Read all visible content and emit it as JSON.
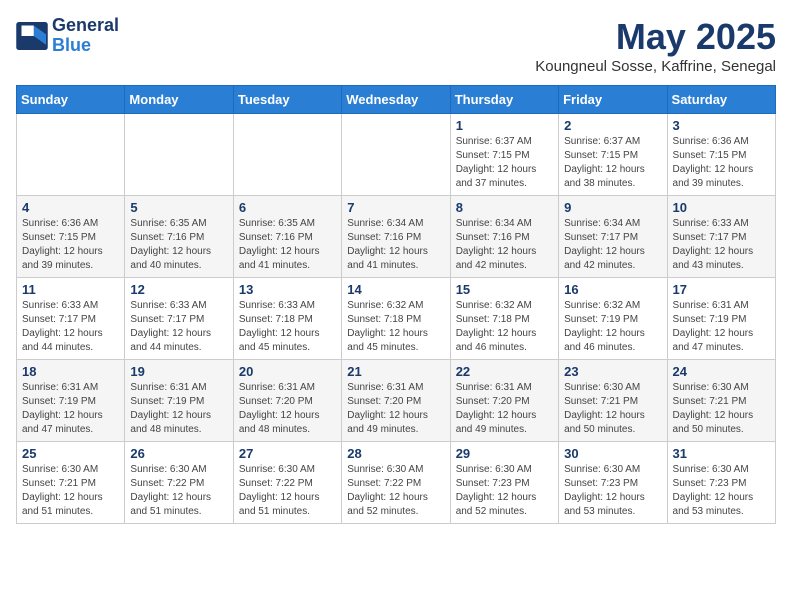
{
  "header": {
    "logo_line1": "General",
    "logo_line2": "Blue",
    "month": "May 2025",
    "location": "Koungneul Sosse, Kaffrine, Senegal"
  },
  "weekdays": [
    "Sunday",
    "Monday",
    "Tuesday",
    "Wednesday",
    "Thursday",
    "Friday",
    "Saturday"
  ],
  "weeks": [
    [
      {
        "day": "",
        "info": ""
      },
      {
        "day": "",
        "info": ""
      },
      {
        "day": "",
        "info": ""
      },
      {
        "day": "",
        "info": ""
      },
      {
        "day": "1",
        "info": "Sunrise: 6:37 AM\nSunset: 7:15 PM\nDaylight: 12 hours and 37 minutes."
      },
      {
        "day": "2",
        "info": "Sunrise: 6:37 AM\nSunset: 7:15 PM\nDaylight: 12 hours and 38 minutes."
      },
      {
        "day": "3",
        "info": "Sunrise: 6:36 AM\nSunset: 7:15 PM\nDaylight: 12 hours and 39 minutes."
      }
    ],
    [
      {
        "day": "4",
        "info": "Sunrise: 6:36 AM\nSunset: 7:15 PM\nDaylight: 12 hours and 39 minutes."
      },
      {
        "day": "5",
        "info": "Sunrise: 6:35 AM\nSunset: 7:16 PM\nDaylight: 12 hours and 40 minutes."
      },
      {
        "day": "6",
        "info": "Sunrise: 6:35 AM\nSunset: 7:16 PM\nDaylight: 12 hours and 41 minutes."
      },
      {
        "day": "7",
        "info": "Sunrise: 6:34 AM\nSunset: 7:16 PM\nDaylight: 12 hours and 41 minutes."
      },
      {
        "day": "8",
        "info": "Sunrise: 6:34 AM\nSunset: 7:16 PM\nDaylight: 12 hours and 42 minutes."
      },
      {
        "day": "9",
        "info": "Sunrise: 6:34 AM\nSunset: 7:17 PM\nDaylight: 12 hours and 42 minutes."
      },
      {
        "day": "10",
        "info": "Sunrise: 6:33 AM\nSunset: 7:17 PM\nDaylight: 12 hours and 43 minutes."
      }
    ],
    [
      {
        "day": "11",
        "info": "Sunrise: 6:33 AM\nSunset: 7:17 PM\nDaylight: 12 hours and 44 minutes."
      },
      {
        "day": "12",
        "info": "Sunrise: 6:33 AM\nSunset: 7:17 PM\nDaylight: 12 hours and 44 minutes."
      },
      {
        "day": "13",
        "info": "Sunrise: 6:33 AM\nSunset: 7:18 PM\nDaylight: 12 hours and 45 minutes."
      },
      {
        "day": "14",
        "info": "Sunrise: 6:32 AM\nSunset: 7:18 PM\nDaylight: 12 hours and 45 minutes."
      },
      {
        "day": "15",
        "info": "Sunrise: 6:32 AM\nSunset: 7:18 PM\nDaylight: 12 hours and 46 minutes."
      },
      {
        "day": "16",
        "info": "Sunrise: 6:32 AM\nSunset: 7:19 PM\nDaylight: 12 hours and 46 minutes."
      },
      {
        "day": "17",
        "info": "Sunrise: 6:31 AM\nSunset: 7:19 PM\nDaylight: 12 hours and 47 minutes."
      }
    ],
    [
      {
        "day": "18",
        "info": "Sunrise: 6:31 AM\nSunset: 7:19 PM\nDaylight: 12 hours and 47 minutes."
      },
      {
        "day": "19",
        "info": "Sunrise: 6:31 AM\nSunset: 7:19 PM\nDaylight: 12 hours and 48 minutes."
      },
      {
        "day": "20",
        "info": "Sunrise: 6:31 AM\nSunset: 7:20 PM\nDaylight: 12 hours and 48 minutes."
      },
      {
        "day": "21",
        "info": "Sunrise: 6:31 AM\nSunset: 7:20 PM\nDaylight: 12 hours and 49 minutes."
      },
      {
        "day": "22",
        "info": "Sunrise: 6:31 AM\nSunset: 7:20 PM\nDaylight: 12 hours and 49 minutes."
      },
      {
        "day": "23",
        "info": "Sunrise: 6:30 AM\nSunset: 7:21 PM\nDaylight: 12 hours and 50 minutes."
      },
      {
        "day": "24",
        "info": "Sunrise: 6:30 AM\nSunset: 7:21 PM\nDaylight: 12 hours and 50 minutes."
      }
    ],
    [
      {
        "day": "25",
        "info": "Sunrise: 6:30 AM\nSunset: 7:21 PM\nDaylight: 12 hours and 51 minutes."
      },
      {
        "day": "26",
        "info": "Sunrise: 6:30 AM\nSunset: 7:22 PM\nDaylight: 12 hours and 51 minutes."
      },
      {
        "day": "27",
        "info": "Sunrise: 6:30 AM\nSunset: 7:22 PM\nDaylight: 12 hours and 51 minutes."
      },
      {
        "day": "28",
        "info": "Sunrise: 6:30 AM\nSunset: 7:22 PM\nDaylight: 12 hours and 52 minutes."
      },
      {
        "day": "29",
        "info": "Sunrise: 6:30 AM\nSunset: 7:23 PM\nDaylight: 12 hours and 52 minutes."
      },
      {
        "day": "30",
        "info": "Sunrise: 6:30 AM\nSunset: 7:23 PM\nDaylight: 12 hours and 53 minutes."
      },
      {
        "day": "31",
        "info": "Sunrise: 6:30 AM\nSunset: 7:23 PM\nDaylight: 12 hours and 53 minutes."
      }
    ]
  ]
}
